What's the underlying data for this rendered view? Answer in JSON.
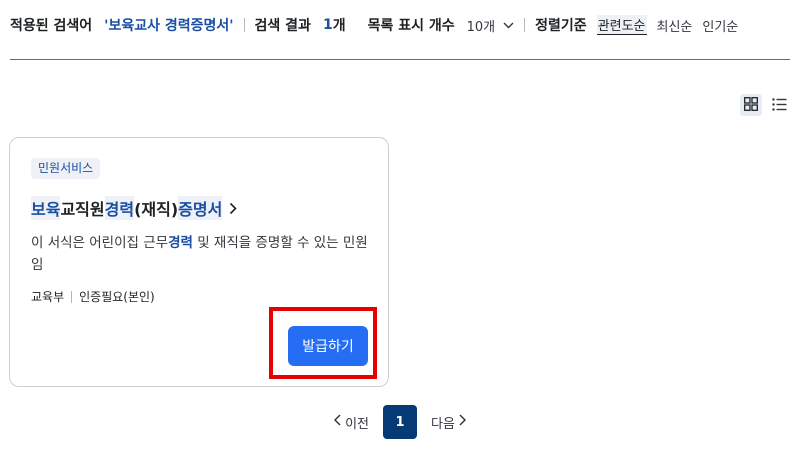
{
  "summary": {
    "applied_label": "적용된 검색어",
    "query": "'보육교사 경력증명서'",
    "result_label": "검색 결과",
    "count": "1",
    "count_unit": "개",
    "listsize_label": "목록 표시 개수",
    "listsize_value": "10개",
    "sort_label": "정렬기준",
    "sort_options": [
      "관련도순",
      "최신순",
      "인기순"
    ],
    "sort_active": "관련도순"
  },
  "view_toggle": {
    "grid_icon": "grid-view-icon",
    "list_icon": "list-view-icon"
  },
  "card": {
    "badge": "민원서비스",
    "title_parts": [
      "보육",
      "교직원 ",
      "경력",
      "(재직) ",
      "증명서"
    ],
    "desc_parts": [
      "이 서식은 어린이집 근무",
      "경력",
      " 및 재직을 증명할 수 있는 민원임"
    ],
    "meta": [
      "교육부",
      "인증필요(본인)"
    ],
    "action_label": "발급하기"
  },
  "pagination": {
    "prev_label": "이전",
    "current": "1",
    "next_label": "다음"
  },
  "colors": {
    "accent": "#256ef4",
    "highlight": "#1a4ea5",
    "focus_ring": "#e80000",
    "page_active": "#063a74"
  }
}
